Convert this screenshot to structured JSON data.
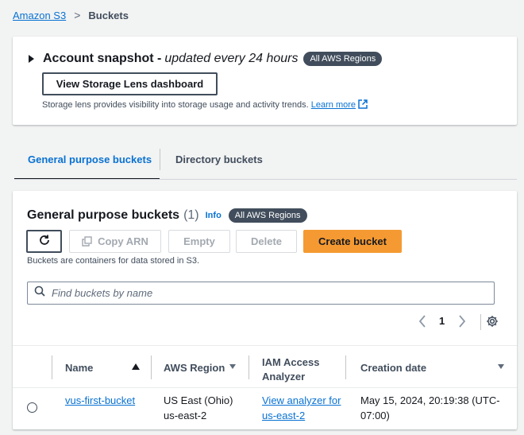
{
  "breadcrumb": {
    "root": "Amazon S3",
    "separator": ">",
    "current": "Buckets"
  },
  "snapshot": {
    "title": "Account snapshot -",
    "subtitle": "updated every 24 hours",
    "region_badge": "All AWS Regions",
    "lens_button": "View Storage Lens dashboard",
    "description": "Storage lens provides visibility into storage usage and activity trends.",
    "learn_more": "Learn more"
  },
  "tabs": [
    {
      "label": "General purpose buckets",
      "active": true
    },
    {
      "label": "Directory buckets",
      "active": false
    }
  ],
  "buckets_panel": {
    "title": "General purpose buckets",
    "count": "(1)",
    "info": "Info",
    "region_badge": "All AWS Regions",
    "actions": {
      "copy_arn": "Copy ARN",
      "empty": "Empty",
      "delete": "Delete",
      "create": "Create bucket"
    },
    "description": "Buckets are containers for data stored in S3.",
    "search_placeholder": "Find buckets by name",
    "page": "1",
    "columns": {
      "name": "Name",
      "region": "AWS Region",
      "iam": "IAM Access Analyzer",
      "date": "Creation date"
    },
    "rows": [
      {
        "name": "vus-first-bucket",
        "region_line1": "US East (Ohio)",
        "region_line2": "us-east-2",
        "iam": "View analyzer for us-east-2",
        "date": "May 15, 2024, 20:19:38 (UTC-07:00)"
      }
    ]
  },
  "colors": {
    "link": "#0972d3",
    "primary_button": "#f59a32",
    "badge": "#414d5c"
  }
}
